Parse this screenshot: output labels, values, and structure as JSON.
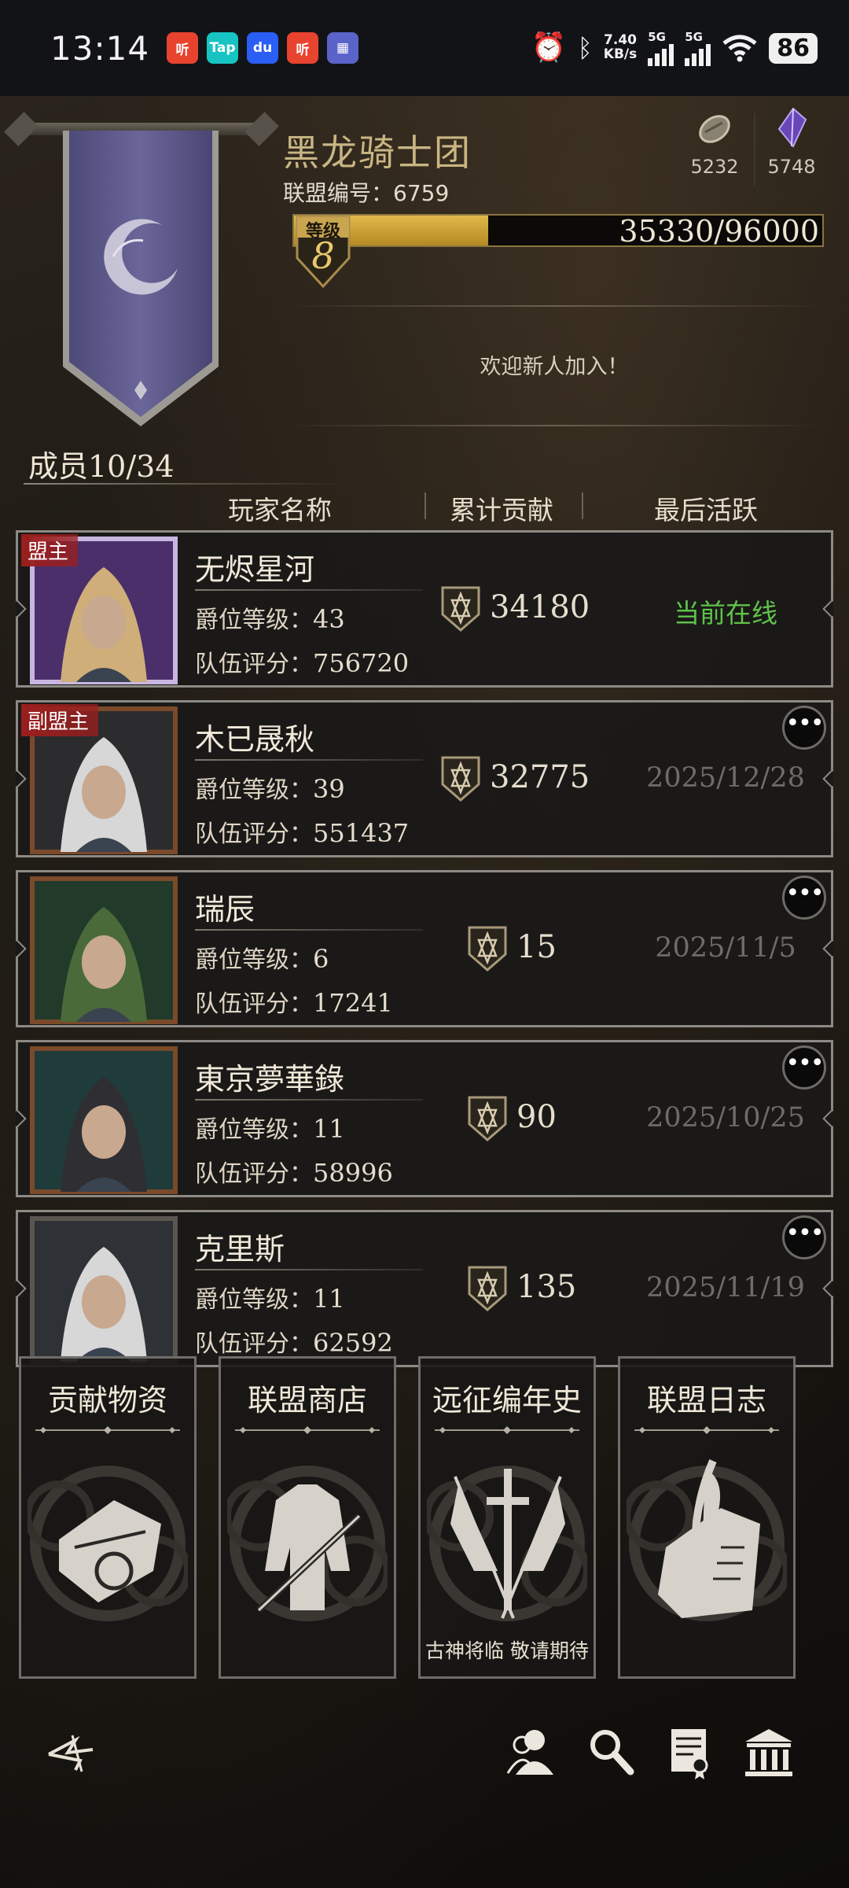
{
  "status_bar": {
    "time": "13:14",
    "apps": [
      {
        "name": "ting-app-icon",
        "label": "听",
        "color": "#e8432f"
      },
      {
        "name": "taptap-icon",
        "label": "Tap",
        "color": "#17c3c3"
      },
      {
        "name": "baidu-icon",
        "label": "du",
        "color": "#2b5ef5"
      },
      {
        "name": "ting-app-icon-2",
        "label": "听",
        "color": "#e8432f"
      },
      {
        "name": "game-app-icon",
        "label": "▦",
        "color": "#5a63c9"
      }
    ],
    "net_speed_value": "7.40",
    "net_speed_unit": "KB/s",
    "signal1_label": "5G",
    "signal2_label": "5G",
    "battery": "86"
  },
  "alliance": {
    "name": "黑龙骑士团",
    "id_label": "联盟编号：",
    "id_value": "6759",
    "currency1": "5232",
    "currency2": "5748",
    "level_label": "等级",
    "level": "8",
    "exp_text": "35330/96000",
    "exp_fraction": 0.368,
    "notice": "欢迎新人加入！"
  },
  "members_label": "成员10/34",
  "columns": {
    "name": "玩家名称",
    "contribution": "累计贡献",
    "last_active": "最后活跃"
  },
  "stat_labels": {
    "rank": "爵位等级：",
    "score": "队伍评分："
  },
  "players": [
    {
      "role": "盟主",
      "name": "无烬星河",
      "rank": "43",
      "score": "756720",
      "contribution": "34180",
      "last_active": "当前在线",
      "online": true,
      "has_more": false
    },
    {
      "role": "副盟主",
      "name": "木已晟秋",
      "rank": "39",
      "score": "551437",
      "contribution": "32775",
      "last_active": "2025/12/28",
      "online": false,
      "has_more": true
    },
    {
      "role": "",
      "name": "瑞辰",
      "rank": "6",
      "score": "17241",
      "contribution": "15",
      "last_active": "2025/11/5",
      "online": false,
      "has_more": true
    },
    {
      "role": "",
      "name": "東京夢華錄",
      "rank": "11",
      "score": "58996",
      "contribution": "90",
      "last_active": "2025/10/25",
      "online": false,
      "has_more": true
    },
    {
      "role": "",
      "name": "克里斯",
      "rank": "11",
      "score": "62592",
      "contribution": "135",
      "last_active": "2025/11/19",
      "online": false,
      "has_more": true
    }
  ],
  "more_glyph": "•••",
  "cards": [
    {
      "title": "贡献物资",
      "sub": "",
      "icon": "scroll-icon"
    },
    {
      "title": "联盟商店",
      "sub": "",
      "icon": "armor-icon"
    },
    {
      "title": "远征编年史",
      "sub": "古神将临 敬请期待",
      "icon": "sword-banners-icon"
    },
    {
      "title": "联盟日志",
      "sub": "",
      "icon": "quill-parchment-icon"
    }
  ],
  "bottom_nav": [
    "back-icon",
    "members-icon",
    "search-icon",
    "certificate-icon",
    "temple-icon"
  ],
  "colors": {
    "gold": "#c9b583",
    "online": "#5fc24a",
    "role_tag": "#9b1e1e",
    "exp_fill": "#e1b84c"
  }
}
